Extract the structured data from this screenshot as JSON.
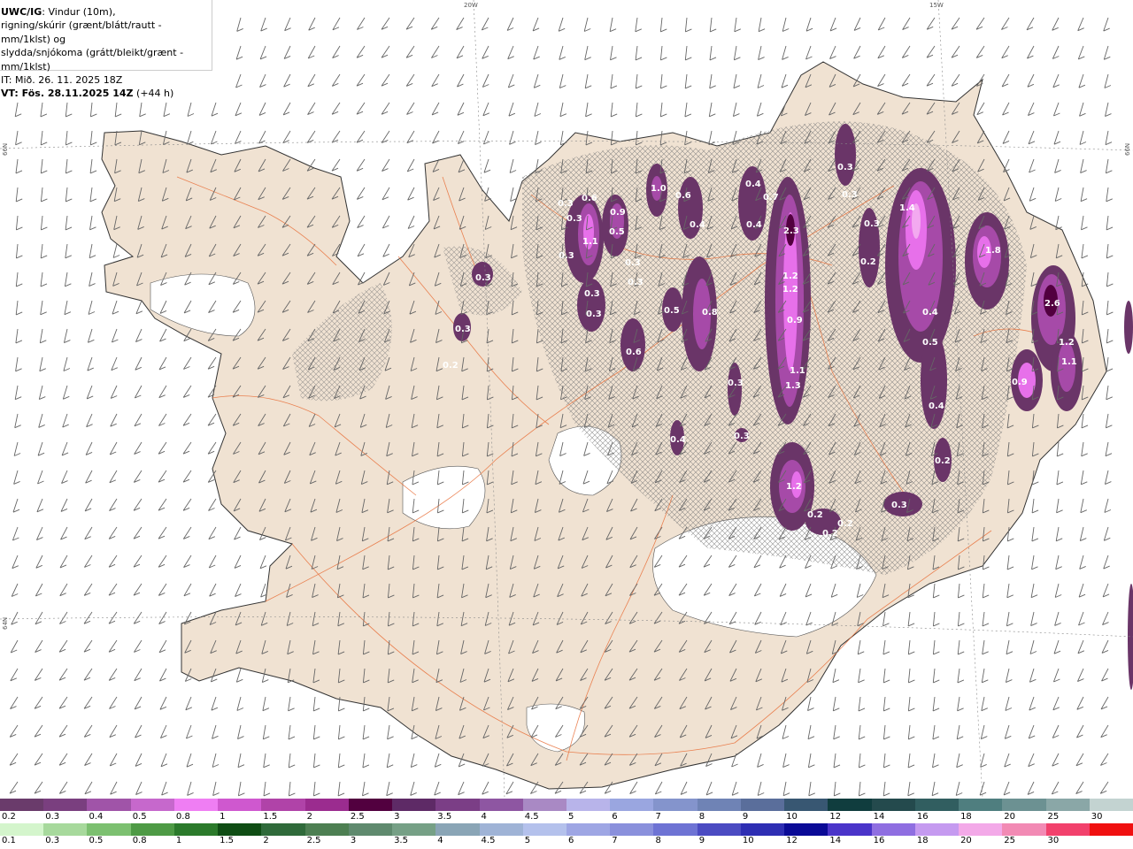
{
  "info": {
    "title": "UWC/IG",
    "title_suffix": ": Vindur (10m),",
    "line2": "rigning/skúrir (grænt/blátt/rautt - mm/1klst) og",
    "line3": "slydda/snjókoma (grátt/bleikt/grænt - mm/1klst)",
    "line4": "IT: Mið. 26. 11. 2025 18Z",
    "vt_label": "VT: Fös. 28.11.2025 14Z",
    "vt_suffix": " (+44 h)"
  },
  "grid_labels": {
    "lon_20w": "20W",
    "lon_15w": "15W",
    "lat_66n_left": "66N",
    "lat_66n_right": "66N",
    "lat_64n_left": "64N"
  },
  "map_labels": [
    "0.3",
    "0.2",
    "0.3",
    "1.1",
    "0.9",
    "0.6",
    "0.5",
    "0.3",
    "1.0",
    "0.6",
    "0.4",
    "0.4",
    "0.7",
    "2.3",
    "0.4",
    "0.3",
    "0.3",
    "0.3",
    "1.4",
    "1.8",
    "2.6",
    "0.3",
    "0.3",
    "0.3",
    "0.3",
    "0.5",
    "0.8",
    "0.3",
    "0.6",
    "1.2",
    "1.2",
    "0.9",
    "1.1",
    "1.3",
    "0.3",
    "0.4",
    "0.5",
    "0.4",
    "0.3",
    "1.2",
    "1.1",
    "0.9",
    "0.4",
    "0.3",
    "0.2",
    "0.2",
    "0.2",
    "0.2",
    "1.2",
    "0.3",
    "0.2"
  ],
  "colors": {
    "land": "#f0e2d2",
    "roads": "#e8703a",
    "coast": "#333333",
    "wind_barbs": "#666666",
    "precip_low": "#6a3568",
    "precip_mid": "#a64aa8",
    "precip_high": "#e770ea",
    "precip_peak": "#f3a9f0"
  },
  "legend_snow": {
    "labels": [
      "0.2",
      "0.3",
      "0.4",
      "0.5",
      "0.8",
      "1",
      "1.5",
      "2",
      "2.5",
      "3",
      "3.5",
      "4",
      "4.5",
      "5",
      "6",
      "7",
      "8",
      "9",
      "10",
      "12",
      "14",
      "16",
      "18",
      "20",
      "25",
      "30"
    ],
    "colors": [
      "#6a3b6b",
      "#7a3f7f",
      "#a054a8",
      "#c668cc",
      "#ef7ef3",
      "#cf58cf",
      "#b043a8",
      "#9b2c8f",
      "#52003f",
      "#5e2a66",
      "#7b3e86",
      "#8e56a2",
      "#a989c4",
      "#b8b4ea",
      "#9aa6e0",
      "#8494cc",
      "#6f83b5",
      "#5a6e9b",
      "#385772",
      "#103d3e",
      "#244a4d",
      "#315e60",
      "#4f7e7f",
      "#6c9192",
      "#8aa7a7",
      "#c3d3d1"
    ]
  },
  "legend_rain": {
    "labels": [
      "0.1",
      "0.3",
      "0.5",
      "0.8",
      "1",
      "1.5",
      "2",
      "2.5",
      "3",
      "3.5",
      "4",
      "4.5",
      "5",
      "6",
      "7",
      "8",
      "9",
      "10",
      "12",
      "14",
      "16",
      "18",
      "20",
      "25",
      "30"
    ],
    "colors": [
      "#d4f5cc",
      "#a7d99c",
      "#7cc070",
      "#4e9a45",
      "#2b7a2b",
      "#0f4d14",
      "#2f6a3a",
      "#4d7f52",
      "#5f8a6e",
      "#76a086",
      "#8aa5b6",
      "#9fb3d6",
      "#b4c1ec",
      "#9ea6e4",
      "#8a90dc",
      "#6e73d4",
      "#4b4bc2",
      "#2e2eb3",
      "#0a0a96",
      "#4a34c9",
      "#8f6ee1",
      "#c59af0",
      "#f3a9e8",
      "#f28ab4",
      "#f2416c",
      "#f01010"
    ]
  }
}
